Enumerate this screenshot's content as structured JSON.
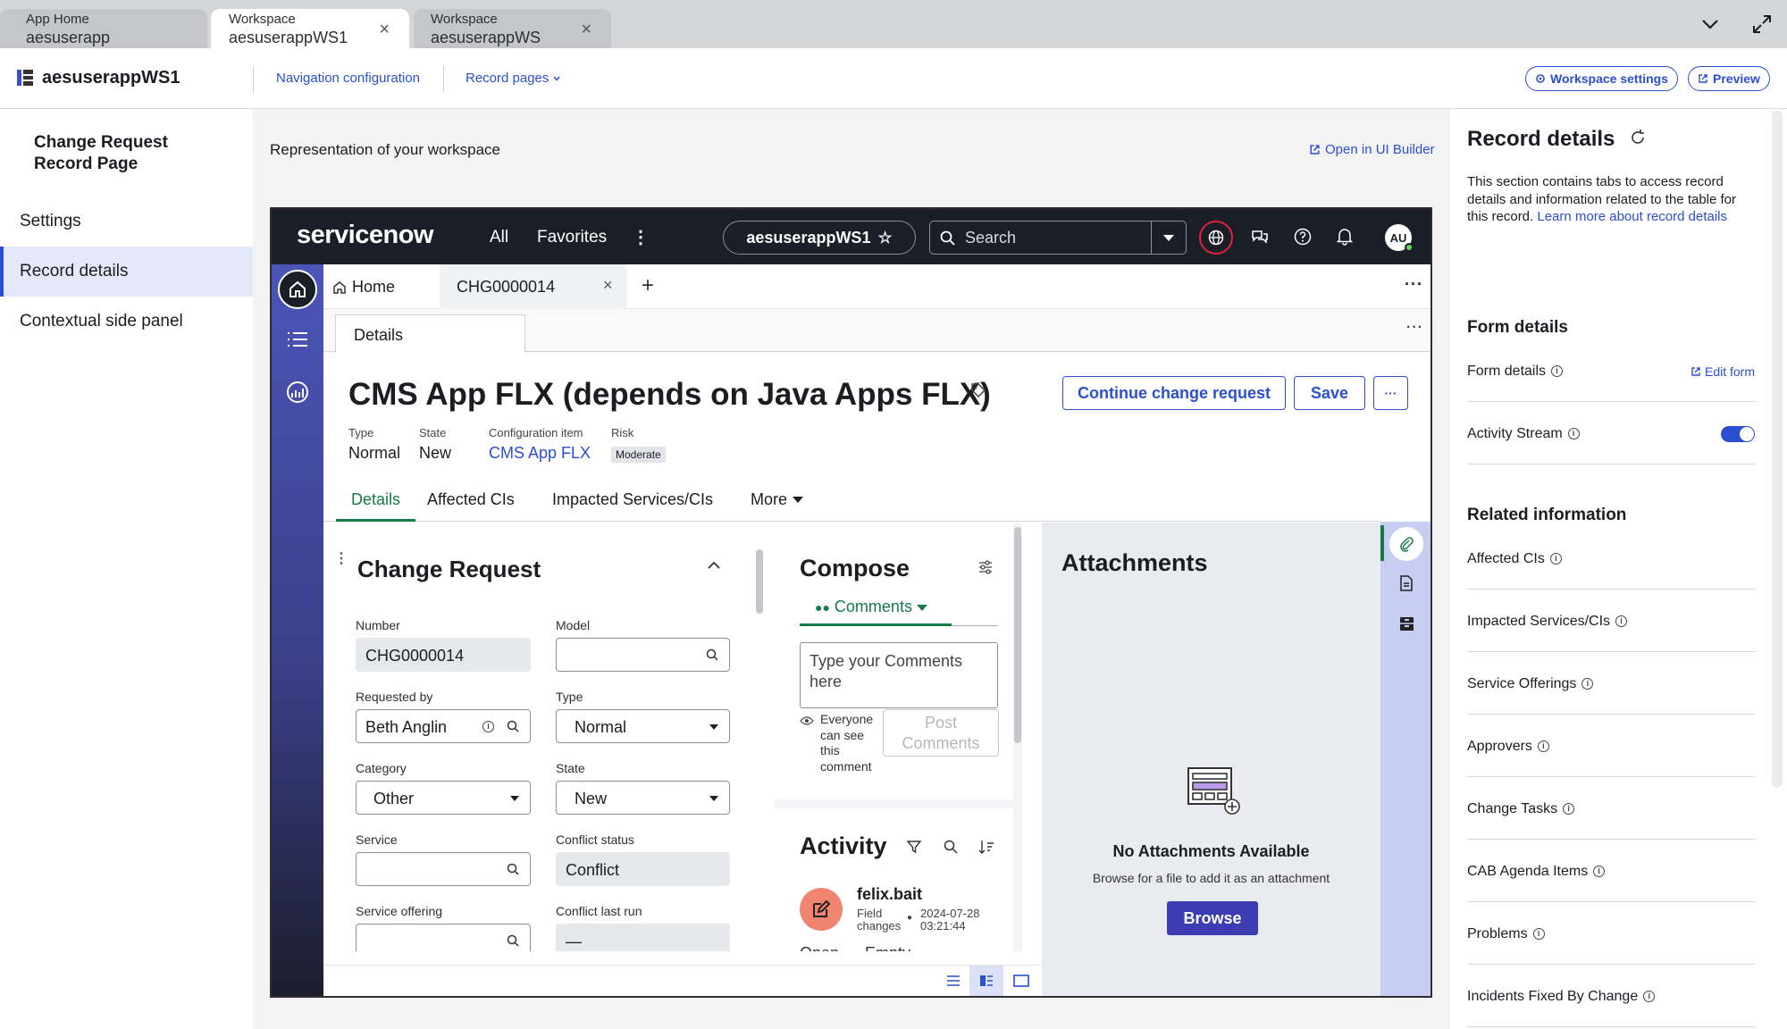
{
  "browser_tabs": [
    {
      "line1": "App Home",
      "line2": "aesuserapp"
    },
    {
      "line1": "Workspace",
      "line2": "aesuserappWS1"
    },
    {
      "line1": "Workspace",
      "line2": "aesuserappWS"
    }
  ],
  "app_header": {
    "workspace_name": "aesuserappWS1",
    "nav_config": "Navigation configuration",
    "record_pages": "Record pages",
    "workspace_settings": "Workspace settings",
    "preview": "Preview"
  },
  "left_nav": {
    "heading": "Change Request Record Page",
    "items": [
      "Settings",
      "Record details",
      "Contextual side panel"
    ]
  },
  "center": {
    "representation": "Representation of your workspace",
    "open_ui_builder": "Open in UI Builder"
  },
  "sn": {
    "logo": "servicenow",
    "nav_all": "All",
    "nav_favorites": "Favorites",
    "workspace_pill": "aesuserappWS1",
    "search_placeholder": "Search",
    "avatar": "AU",
    "tab_home": "Home",
    "tab_record": "CHG0000014",
    "subtab": "Details",
    "record_title": "CMS App FLX (depends on Java Apps FLX)",
    "continue_btn": "Continue change request",
    "save_btn": "Save",
    "meta": {
      "type_label": "Type",
      "type_value": "Normal",
      "state_label": "State",
      "state_value": "New",
      "ci_label": "Configuration item",
      "ci_value": "CMS App FLX",
      "risk_label": "Risk",
      "risk_value": "Moderate"
    },
    "form_tabs": [
      "Details",
      "Affected CIs",
      "Impacted Services/CIs",
      "More"
    ],
    "form": {
      "title": "Change Request",
      "number_label": "Number",
      "number_value": "CHG0000014",
      "model_label": "Model",
      "requested_by_label": "Requested by",
      "requested_by_value": "Beth Anglin",
      "type_label": "Type",
      "type_value": "Normal",
      "category_label": "Category",
      "category_value": "Other",
      "state_label": "State",
      "state_value": "New",
      "service_label": "Service",
      "conflict_status_label": "Conflict status",
      "conflict_status_value": "Conflict",
      "service_offering_label": "Service offering",
      "conflict_last_run_label": "Conflict last run",
      "conflict_last_run_value": "—"
    },
    "compose": {
      "title": "Compose",
      "comments_tab": "Comments",
      "placeholder": "Type your Comments here",
      "visibility": "Everyone can see this comment",
      "post_btn": "Post Comments"
    },
    "activity": {
      "title": "Activity",
      "user": "felix.bait",
      "kind": "Field changes",
      "timestamp": "2024-07-28 03:21:44",
      "cut1": "Open",
      "cut2": "Empty"
    },
    "attachments": {
      "title": "Attachments",
      "empty_title": "No Attachments Available",
      "empty_sub": "Browse for a file to add it as an attachment",
      "browse_btn": "Browse"
    }
  },
  "right_panel": {
    "title": "Record details",
    "description": "This section contains tabs to access record details and information related to the table for this record.",
    "learn_more": "Learn more about record details",
    "form_details_heading": "Form details",
    "form_details_label": "Form details",
    "edit_form": "Edit form",
    "activity_stream": "Activity Stream",
    "activity_stream_on": true,
    "related_heading": "Related information",
    "related_items": [
      "Affected CIs",
      "Impacted Services/CIs",
      "Service Offerings",
      "Approvers",
      "Change Tasks",
      "CAB Agenda Items",
      "Problems",
      "Incidents Fixed By Change"
    ]
  },
  "colors": {
    "accent": "#2b4fd1",
    "sn_header": "#1a1e26",
    "sn_green": "#62d84e",
    "browse_btn": "#3d3db3",
    "selected_nav": "#e3e9fb"
  }
}
